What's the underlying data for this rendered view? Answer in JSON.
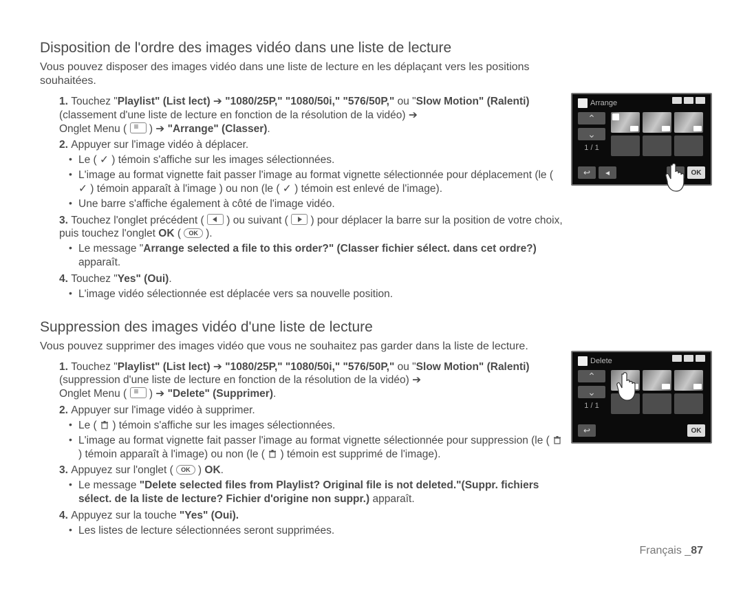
{
  "section1": {
    "heading": "Disposition de l'ordre des images vidéo dans une liste de lecture",
    "lead": "Vous pouvez disposer des images vidéo dans une liste de lecture en les déplaçant vers les positions souhaitées.",
    "s1a": "Touchez \"",
    "s1b": "Playlist\" (List lect)",
    "s1c": "\"1080/25P,\" \"1080/50i,\" \"576/50P,\"",
    "s1d": " ou \"",
    "s1e": "Slow Motion\" (Ralenti)",
    "s1f": " (classement d'une liste de lecture en fonction de la résolution de la vidéo) ",
    "s1g": "Onglet Menu ( ",
    "s1h": "\"Arrange\" (Classer)",
    "s2": "Appuyer sur l'image vidéo à déplacer.",
    "s2a": "Le ( ✓ ) témoin s'affiche sur les images sélectionnées.",
    "s2b": "L'image au format vignette fait passer l'image au format vignette sélectionnée pour déplacement (le ( ✓ ) témoin apparaît à l'image ) ou non (le ( ✓ ) témoin est enlevé de l'image).",
    "s2c": "Une barre s'affiche également à côté de l'image vidéo.",
    "s3a": "Touchez l'onglet précédent ( ",
    "s3b": " ) ou suivant ( ",
    "s3c": " ) pour déplacer la barre sur la position de votre choix, puis touchez l'onglet ",
    "s3d": "OK",
    "s3e": " ( ",
    "s3f": " ).",
    "s3g": "Le message \"",
    "s3h": "Arrange selected a file to this order?\" (Classer fichier sélect. dans cet ordre?)",
    "s3i": " apparaît.",
    "s4a": "Touchez \"",
    "s4b": "Yes\" (Oui)",
    "s4c": ".",
    "s4d": "L'image vidéo sélectionnée est déplacée vers sa nouvelle position."
  },
  "section2": {
    "heading": "Suppression des images vidéo d'une liste de lecture",
    "lead": "Vous pouvez supprimer des images vidéo que vous ne souhaitez pas garder dans la liste de lecture.",
    "s1a": "Touchez \"",
    "s1b": "Playlist\" (List lect)",
    "s1c": "\"1080/25P,\" \"1080/50i,\" \"576/50P,\"",
    "s1d": " ou \"",
    "s1e": "Slow Motion\" (Ralenti)",
    "s1f": " (suppression d'une liste de lecture en fonction de la résolution de la vidéo) ",
    "s1g": "Onglet Menu ( ",
    "s1h": "\"Delete\" (Supprimer)",
    "s2": "Appuyer sur l'image vidéo à supprimer.",
    "s2a1": "Le ( ",
    "s2a2": " ) témoin s'affiche sur les images sélectionnées.",
    "s2b1": "L'image au format vignette fait passer l'image au format vignette sélectionnée pour suppression (le ( ",
    "s2b2": " ) témoin apparaît à l'image) ou non (le ( ",
    "s2b3": " ) témoin est supprimé de l'image).",
    "s3a": "Appuyez sur l'onglet ( ",
    "s3b": " ) ",
    "s3c": "OK",
    "s3d": ".",
    "s3e": "Le message ",
    "s3f": "\"Delete selected files from Playlist? Original file is not deleted.\"(Suppr. fichiers sélect. de la liste de lecture? Fichier d'origine non suppr.)",
    "s3g": " apparaît.",
    "s4a": "Appuyez sur la touche ",
    "s4b": "\"Yes\" (Oui).",
    "s4c": "Les listes de lecture sélectionnées seront supprimées."
  },
  "device": {
    "arrange_title": "Arrange",
    "delete_title": "Delete",
    "page_indicator": "1 / 1",
    "ok": "OK"
  },
  "footer": {
    "lang": "Français _",
    "page": "87"
  },
  "glyph": {
    "arrow": " ➔ "
  }
}
